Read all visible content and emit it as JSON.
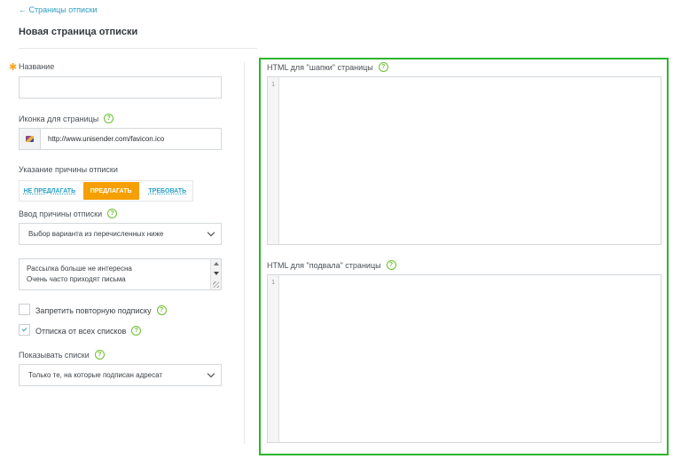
{
  "header": {
    "back_link": "← Страницы отписки",
    "title": "Новая страница отписки"
  },
  "form": {
    "name_label": "Название",
    "name_value": "",
    "icon_label": "Иконка для страницы",
    "icon_url": "http://www.unisender.com/favicon.ico",
    "reason_mode_label": "Указание причины отписки",
    "reason_modes": [
      "НЕ ПРЕДЛАГАТЬ",
      "ПРЕДЛАГАТЬ",
      "ТРЕБОВАТЬ"
    ],
    "reason_mode_selected": "ПРЕДЛАГАТЬ",
    "reason_input_label": "Ввод причины отписки",
    "reason_input_value": "Выбор варианта из перечисленных ниже",
    "reasons_list": [
      "Рассылка больше не интересна",
      "Очень часто приходят письма"
    ],
    "forbid_resubscribe_label": "Запретить повторную подписку",
    "forbid_resubscribe_checked": false,
    "unsubscribe_all_label": "Отписка от всех списков",
    "unsubscribe_all_checked": true,
    "show_lists_label": "Показывать списки",
    "show_lists_value": "Только те, на которые подписан адресат",
    "help_mark": "?"
  },
  "editors": {
    "header_label": "HTML для \"шапки\" страницы",
    "footer_label": "HTML для \"подвала\" страницы",
    "line_number": "1"
  },
  "colors": {
    "accent": "#2a9fc4",
    "active_segment": "#f5a000",
    "help_green": "#6cbf2e",
    "highlight_frame": "#2db52d"
  }
}
